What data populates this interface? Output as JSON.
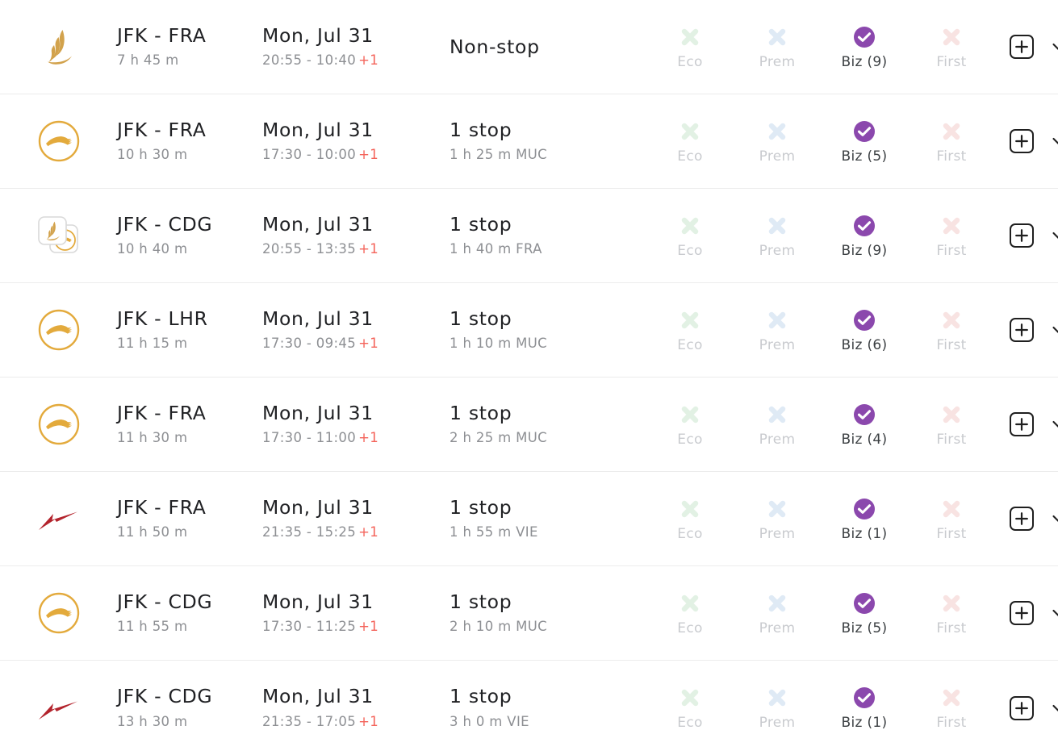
{
  "cabin_columns": [
    {
      "key": "eco",
      "label": "Eco"
    },
    {
      "key": "prem",
      "label": "Prem"
    },
    {
      "key": "biz",
      "label": "Biz"
    },
    {
      "key": "first",
      "label": "First"
    }
  ],
  "colors": {
    "eco_x": "#e2f1e4",
    "prem_x": "#dfeaf5",
    "first_x": "#f8e3e2",
    "biz_check": "#8b48ad",
    "plus_day": "#f4635a",
    "logo_lufthansa": "#e3aa3c",
    "logo_singapore": "#d2a24c",
    "logo_austrian": "#b3232c",
    "row_divider": "#ececec",
    "text_primary": "#202124",
    "text_muted": "#8d8f93",
    "label_disabled": "#c9cbcf"
  },
  "icons": {
    "add": "plus-in-square-icon",
    "expand": "chevron-down-icon",
    "unavailable": "x-mark-icon",
    "available": "check-circle-icon"
  },
  "flights": [
    {
      "airline_logo": "singapore-airlines-logo",
      "route": "JFK - FRA",
      "duration": "7 h 45 m",
      "date": "Mon, Jul 31",
      "times": "20:55 - 10:40",
      "day_offset": "+1",
      "stops": "Non-stop",
      "layover": "",
      "cabins": {
        "eco": {
          "available": false,
          "label": "Eco"
        },
        "prem": {
          "available": false,
          "label": "Prem"
        },
        "biz": {
          "available": true,
          "label": "Biz (9)"
        },
        "first": {
          "available": false,
          "label": "First"
        }
      }
    },
    {
      "airline_logo": "lufthansa-logo",
      "route": "JFK - FRA",
      "duration": "10 h 30 m",
      "date": "Mon, Jul 31",
      "times": "17:30 - 10:00",
      "day_offset": "+1",
      "stops": "1 stop",
      "layover": "1 h 25 m MUC",
      "cabins": {
        "eco": {
          "available": false,
          "label": "Eco"
        },
        "prem": {
          "available": false,
          "label": "Prem"
        },
        "biz": {
          "available": true,
          "label": "Biz (5)"
        },
        "first": {
          "available": false,
          "label": "First"
        }
      }
    },
    {
      "airline_logo": "multi-airline-logo",
      "route": "JFK - CDG",
      "duration": "10 h 40 m",
      "date": "Mon, Jul 31",
      "times": "20:55 - 13:35",
      "day_offset": "+1",
      "stops": "1 stop",
      "layover": "1 h 40 m FRA",
      "cabins": {
        "eco": {
          "available": false,
          "label": "Eco"
        },
        "prem": {
          "available": false,
          "label": "Prem"
        },
        "biz": {
          "available": true,
          "label": "Biz (9)"
        },
        "first": {
          "available": false,
          "label": "First"
        }
      }
    },
    {
      "airline_logo": "lufthansa-logo",
      "route": "JFK - LHR",
      "duration": "11 h 15 m",
      "date": "Mon, Jul 31",
      "times": "17:30 - 09:45",
      "day_offset": "+1",
      "stops": "1 stop",
      "layover": "1 h 10 m MUC",
      "cabins": {
        "eco": {
          "available": false,
          "label": "Eco"
        },
        "prem": {
          "available": false,
          "label": "Prem"
        },
        "biz": {
          "available": true,
          "label": "Biz (6)"
        },
        "first": {
          "available": false,
          "label": "First"
        }
      }
    },
    {
      "airline_logo": "lufthansa-logo",
      "route": "JFK - FRA",
      "duration": "11 h 30 m",
      "date": "Mon, Jul 31",
      "times": "17:30 - 11:00",
      "day_offset": "+1",
      "stops": "1 stop",
      "layover": "2 h 25 m MUC",
      "cabins": {
        "eco": {
          "available": false,
          "label": "Eco"
        },
        "prem": {
          "available": false,
          "label": "Prem"
        },
        "biz": {
          "available": true,
          "label": "Biz (4)"
        },
        "first": {
          "available": false,
          "label": "First"
        }
      }
    },
    {
      "airline_logo": "austrian-airlines-logo",
      "route": "JFK - FRA",
      "duration": "11 h 50 m",
      "date": "Mon, Jul 31",
      "times": "21:35 - 15:25",
      "day_offset": "+1",
      "stops": "1 stop",
      "layover": "1 h 55 m VIE",
      "cabins": {
        "eco": {
          "available": false,
          "label": "Eco"
        },
        "prem": {
          "available": false,
          "label": "Prem"
        },
        "biz": {
          "available": true,
          "label": "Biz (1)"
        },
        "first": {
          "available": false,
          "label": "First"
        }
      }
    },
    {
      "airline_logo": "lufthansa-logo",
      "route": "JFK - CDG",
      "duration": "11 h 55 m",
      "date": "Mon, Jul 31",
      "times": "17:30 - 11:25",
      "day_offset": "+1",
      "stops": "1 stop",
      "layover": "2 h 10 m MUC",
      "cabins": {
        "eco": {
          "available": false,
          "label": "Eco"
        },
        "prem": {
          "available": false,
          "label": "Prem"
        },
        "biz": {
          "available": true,
          "label": "Biz (5)"
        },
        "first": {
          "available": false,
          "label": "First"
        }
      }
    },
    {
      "airline_logo": "austrian-airlines-logo",
      "route": "JFK - CDG",
      "duration": "13 h 30 m",
      "date": "Mon, Jul 31",
      "times": "21:35 - 17:05",
      "day_offset": "+1",
      "stops": "1 stop",
      "layover": "3 h 0 m VIE",
      "cabins": {
        "eco": {
          "available": false,
          "label": "Eco"
        },
        "prem": {
          "available": false,
          "label": "Prem"
        },
        "biz": {
          "available": true,
          "label": "Biz (1)"
        },
        "first": {
          "available": false,
          "label": "First"
        }
      }
    }
  ]
}
